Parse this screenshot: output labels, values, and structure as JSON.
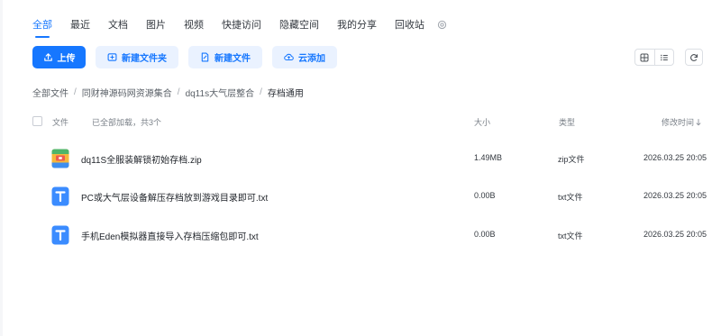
{
  "tabs": [
    {
      "label": "全部",
      "active": true
    },
    {
      "label": "最近"
    },
    {
      "label": "文档"
    },
    {
      "label": "图片"
    },
    {
      "label": "视频"
    },
    {
      "label": "快捷访问"
    },
    {
      "label": "隐藏空间"
    },
    {
      "label": "我的分享"
    },
    {
      "label": "回收站"
    }
  ],
  "toolbar": {
    "upload": "上传",
    "new_folder": "新建文件夹",
    "new_file": "新建文件",
    "cloud_add": "云添加"
  },
  "breadcrumb": [
    "全部文件",
    "同财神源码网资源集合",
    "dq11s大气层整合",
    "存档通用"
  ],
  "table": {
    "headers": {
      "name": "文件",
      "loaded": "已全部加载，共3个",
      "size": "大小",
      "type": "类型",
      "time": "修改时间"
    },
    "rows": [
      {
        "name": "dq11S全服装解锁初始存档.zip",
        "size": "1.49MB",
        "type": "zip文件",
        "time": "2026.03.25 20:05",
        "icon": "zip-file-icon"
      },
      {
        "name": "PC或大气层设备解压存档放到游戏目录即可.txt",
        "size": "0.00B",
        "type": "txt文件",
        "time": "2026.03.25 20:05",
        "icon": "txt-file-icon"
      },
      {
        "name": "手机Eden模拟器直接导入存档压缩包即可.txt",
        "size": "0.00B",
        "type": "txt文件",
        "time": "2026.03.25 20:05",
        "icon": "txt-file-icon"
      }
    ]
  },
  "colors": {
    "accent": "#1677ff",
    "accent_soft": "#eaf2ff",
    "txt_icon": "#3b8cff"
  }
}
